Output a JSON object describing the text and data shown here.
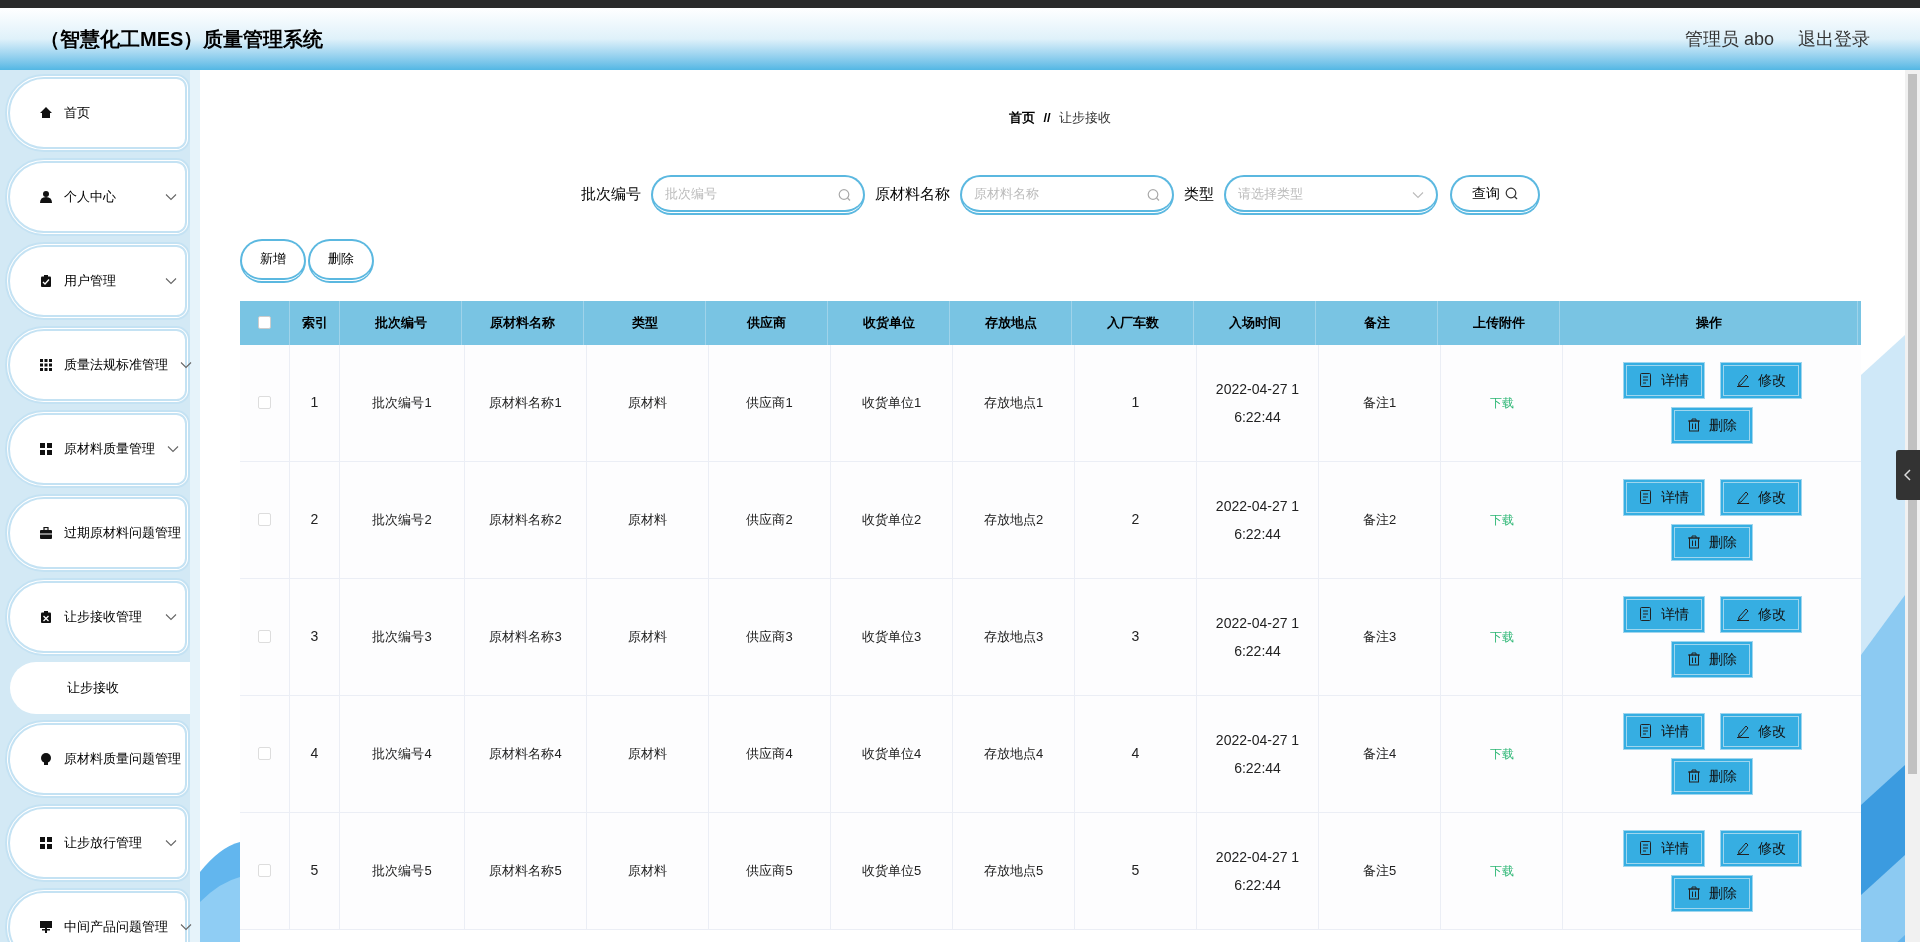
{
  "header": {
    "title": "（智慧化工MES）质量管理系统",
    "user": "管理员 abo",
    "logout": "退出登录"
  },
  "sidebar": {
    "items": [
      {
        "label": "首页"
      },
      {
        "label": "个人中心",
        "has_submenu": true
      },
      {
        "label": "用户管理",
        "has_submenu": true
      },
      {
        "label": "质量法规标准管理",
        "has_submenu": true
      },
      {
        "label": "原材料质量管理",
        "has_submenu": true
      },
      {
        "label": "过期原材料问题管理"
      },
      {
        "label": "让步接收管理",
        "has_submenu": true,
        "children": [
          {
            "label": "让步接收"
          }
        ]
      },
      {
        "label": "原材料质量问题管理"
      },
      {
        "label": "让步放行管理",
        "has_submenu": true
      },
      {
        "label": "中间产品问题管理",
        "has_submenu": true
      }
    ]
  },
  "breadcrumb": {
    "home": "首页",
    "separator": "//",
    "current": "让步接收"
  },
  "search": {
    "fields": [
      {
        "kind": "text",
        "label": "批次编号",
        "placeholder": "批次编号"
      },
      {
        "kind": "text",
        "label": "原材料名称",
        "placeholder": "原材料名称"
      },
      {
        "kind": "select",
        "label": "类型",
        "placeholder": "请选择类型"
      }
    ],
    "button": "查询"
  },
  "toolbar": [
    "新增",
    "删除"
  ],
  "table": {
    "select_all": false,
    "columns": [
      "索引",
      "批次编号",
      "原材料名称",
      "类型",
      "供应商",
      "收货单位",
      "存放地点",
      "入厂车数",
      "入场时间",
      "备注",
      "上传附件",
      "操作"
    ],
    "rows": [
      {
        "checked": false,
        "cells": [
          "1",
          "批次编号1",
          "原材料名称1",
          "原材料",
          "供应商1",
          "收货单位1",
          "存放地点1",
          "1",
          "2022-04-27 16:22:44",
          "备注1"
        ],
        "attachment": "下载",
        "actions": [
          "详情",
          "修改",
          "删除"
        ]
      },
      {
        "checked": false,
        "cells": [
          "2",
          "批次编号2",
          "原材料名称2",
          "原材料",
          "供应商2",
          "收货单位2",
          "存放地点2",
          "2",
          "2022-04-27 16:22:44",
          "备注2"
        ],
        "attachment": "下载",
        "actions": [
          "详情",
          "修改",
          "删除"
        ]
      },
      {
        "checked": false,
        "cells": [
          "3",
          "批次编号3",
          "原材料名称3",
          "原材料",
          "供应商3",
          "收货单位3",
          "存放地点3",
          "3",
          "2022-04-27 16:22:44",
          "备注3"
        ],
        "attachment": "下载",
        "actions": [
          "详情",
          "修改",
          "删除"
        ]
      },
      {
        "checked": false,
        "cells": [
          "4",
          "批次编号4",
          "原材料名称4",
          "原材料",
          "供应商4",
          "收货单位4",
          "存放地点4",
          "4",
          "2022-04-27 16:22:44",
          "备注4"
        ],
        "attachment": "下载",
        "actions": [
          "详情",
          "修改",
          "删除"
        ]
      },
      {
        "checked": false,
        "cells": [
          "5",
          "批次编号5",
          "原材料名称5",
          "原材料",
          "供应商5",
          "收货单位5",
          "存放地点5",
          "5",
          "2022-04-27 16:22:44",
          "备注5"
        ],
        "attachment": "下载",
        "actions": [
          "详情",
          "修改",
          "删除"
        ]
      }
    ]
  }
}
